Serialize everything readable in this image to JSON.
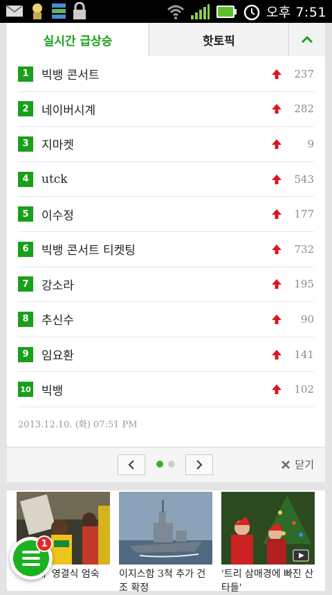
{
  "status_bar": {
    "time": "오후 7:51"
  },
  "tabs": {
    "realtime": "실시간 급상승",
    "hot_topic": "핫토픽"
  },
  "ranking": [
    {
      "rank": "1",
      "keyword": "빅뱅 콘서트",
      "count": "237"
    },
    {
      "rank": "2",
      "keyword": "네이버시계",
      "count": "282"
    },
    {
      "rank": "3",
      "keyword": "지마켓",
      "count": "9"
    },
    {
      "rank": "4",
      "keyword": "utck",
      "count": "543"
    },
    {
      "rank": "5",
      "keyword": "이수정",
      "count": "177"
    },
    {
      "rank": "6",
      "keyword": "빅뱅 콘서트 티켓팅",
      "count": "732"
    },
    {
      "rank": "7",
      "keyword": "강소라",
      "count": "195"
    },
    {
      "rank": "8",
      "keyword": "추신수",
      "count": "90"
    },
    {
      "rank": "9",
      "keyword": "임요환",
      "count": "141"
    },
    {
      "rank": "10",
      "keyword": "빅뱅",
      "count": "102"
    }
  ],
  "timestamp": "2013.12.10. (화) 07:51 PM",
  "pager": {
    "close_label": "닫기"
  },
  "news": [
    {
      "caption": "'무지개' 영결식 엄숙"
    },
    {
      "caption": "이지스함 3척 추가 건조 확정"
    },
    {
      "caption": "'트리 삼매경에 빠진 산타들'"
    }
  ],
  "fab": {
    "badge": "1"
  },
  "colors": {
    "accent": "#19a01a",
    "up_arrow": "#e0141e",
    "badge": "#e02a2a"
  }
}
